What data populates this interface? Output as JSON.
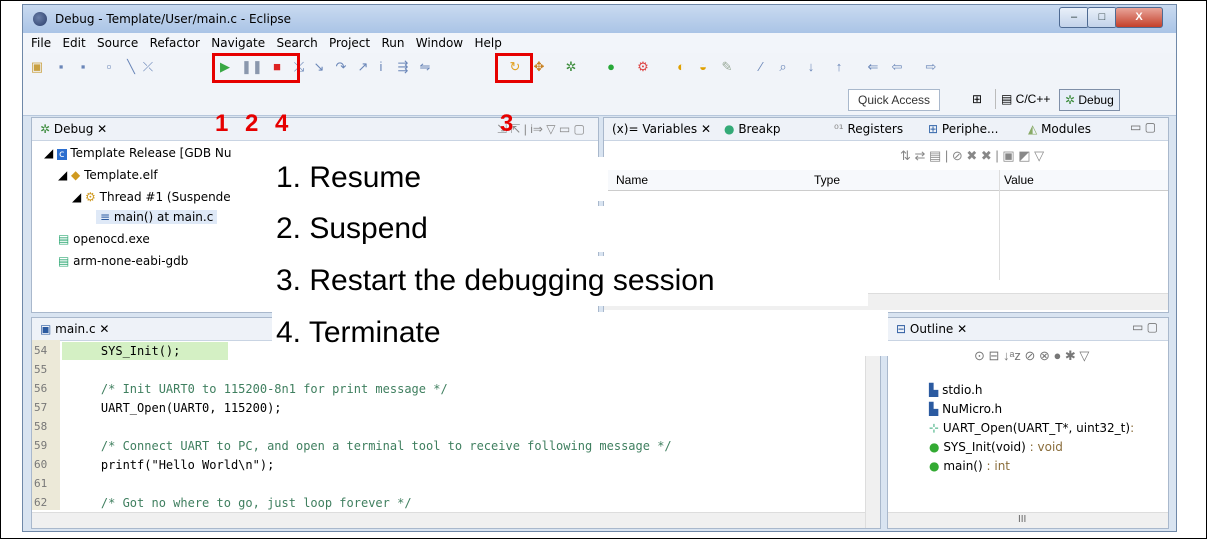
{
  "window": {
    "title": "Debug - Template/User/main.c - Eclipse",
    "min_label": "–",
    "max_label": "□",
    "close_label": "X"
  },
  "menu": [
    "File",
    "Edit",
    "Source",
    "Refactor",
    "Navigate",
    "Search",
    "Project",
    "Run",
    "Window",
    "Help"
  ],
  "toolbar2": {
    "quick_access": "Quick Access",
    "perspective_cpp": "C/C++",
    "perspective_debug": "Debug"
  },
  "debug_view": {
    "tab": "Debug",
    "items": [
      "Template Release [GDB Nu",
      "Template.elf",
      "Thread #1 (Suspende",
      "main() at main.c",
      "openocd.exe",
      "arm-none-eabi-gdb"
    ]
  },
  "variables_view": {
    "tabs": [
      "(x)= Variables",
      "Breakp",
      "Registers",
      "Periphe...",
      "Modules"
    ],
    "columns": [
      "Name",
      "Type",
      "Value"
    ]
  },
  "editor": {
    "tab": "main.c",
    "lines": [
      {
        "n": "54",
        "text": "    SYS_Init();"
      },
      {
        "n": "55",
        "text": ""
      },
      {
        "n": "56",
        "text": "    /* Init UART0 to 115200-8n1 for print message */"
      },
      {
        "n": "57",
        "text": "    UART_Open(UART0, 115200);"
      },
      {
        "n": "58",
        "text": ""
      },
      {
        "n": "59",
        "text": "    /* Connect UART to PC, and open a terminal tool to receive following message */"
      },
      {
        "n": "60",
        "text": "    printf(\"Hello World\\n\");"
      },
      {
        "n": "61",
        "text": ""
      },
      {
        "n": "62",
        "text": "    /* Got no where to go, just loop forever */"
      }
    ]
  },
  "outline": {
    "tab": "Outline",
    "items": [
      {
        "name": "stdio.h",
        "type": ""
      },
      {
        "name": "NuMicro.h",
        "type": ""
      },
      {
        "name": "UART_Open(UART_T*, uint32_t)",
        "type": ":"
      },
      {
        "name": "SYS_Init(void)",
        "type": ": void"
      },
      {
        "name": "main()",
        "type": ": int"
      }
    ],
    "scroll_label": "III"
  },
  "annotations": {
    "numbers_left": [
      "1",
      "2",
      "4"
    ],
    "number_right": "3",
    "legend": [
      "1. Resume",
      "2. Suspend",
      "3. Restart the debugging session",
      "4. Terminate"
    ]
  }
}
